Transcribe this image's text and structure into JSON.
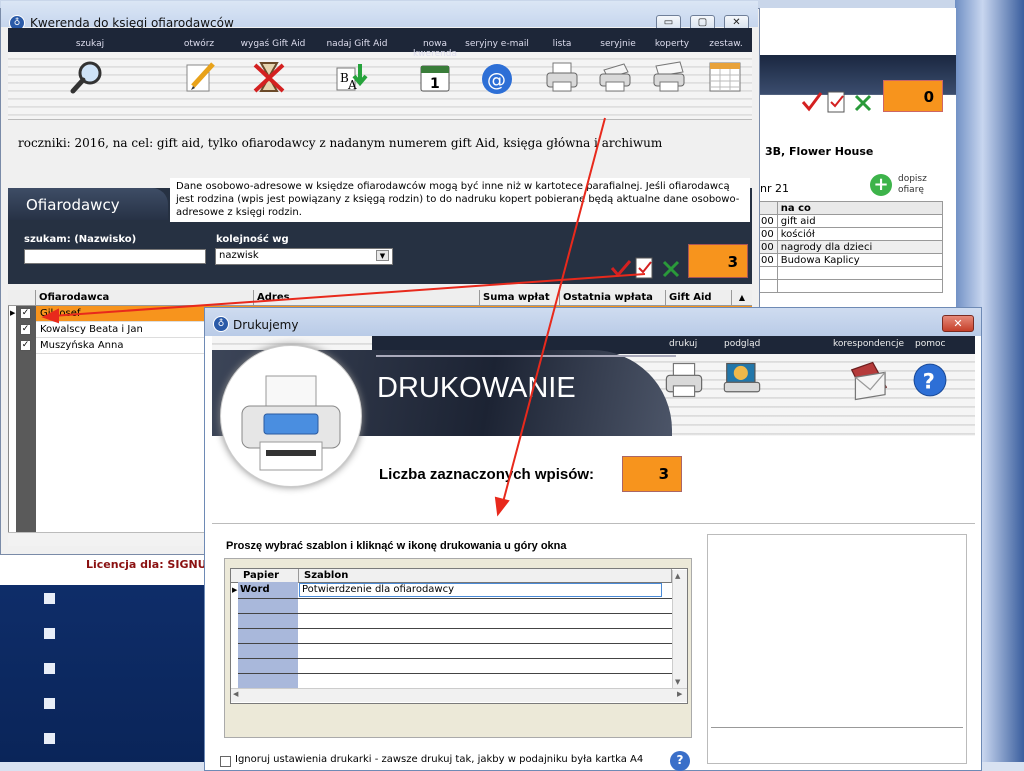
{
  "background": {
    "license_text": "Licencja dla: SIGNUM",
    "accent_red": "#e8291c",
    "accent_orange": "#f7941d",
    "right_panel": {
      "count": "0",
      "address": "3B, Flower House",
      "nr_label": "nr 21",
      "add_label_line1": "dopisz",
      "add_label_line2": "ofiarę",
      "table_header": [
        "",
        "na co"
      ],
      "table_rows": [
        [
          "00",
          "gift aid"
        ],
        [
          "00",
          "kościół"
        ],
        [
          "00",
          "nagrody dla dzieci"
        ],
        [
          "00",
          "Budowa Kaplicy"
        ]
      ]
    }
  },
  "window1": {
    "title": "Kwerenda do księgi ofiarodawców",
    "controls": {
      "minimize": "▭",
      "maximize": "▢",
      "close": "✕"
    },
    "toolbar": [
      {
        "label": "szukaj",
        "icon": "magnifier-icon"
      },
      {
        "label": "otwórz",
        "icon": "pencil-note-icon"
      },
      {
        "label": "wygaś Gift Aid",
        "icon": "hourglass-x-icon"
      },
      {
        "label": "nadaj Gift Aid",
        "icon": "ba-arrow-icon"
      },
      {
        "label": "nowa kwerenda",
        "icon": "calendar-icon"
      },
      {
        "label": "seryjny e-mail",
        "icon": "at-icon"
      },
      {
        "label": "lista",
        "icon": "printer-icon"
      },
      {
        "label": "seryjnie",
        "icon": "printer-icon"
      },
      {
        "label": "koperty",
        "icon": "envelope-printer-icon"
      },
      {
        "label": "zestaw.",
        "icon": "spreadsheet-icon"
      }
    ],
    "query_description": "roczniki: 2016,  na cel: gift aid,  tylko ofiarodawcy z nadanym numerem gift Aid,  księga główna i archiwum",
    "panel_title": "Ofiarodawcy",
    "info_text": "Dane osobowo-adresowe w księdze ofiarodawców mogą być inne niż w kartotece parafialnej. Jeśli ofiarodawcą jest rodzina (wpis jest powiązany z księgą rodzin) to do nadruku kopert pobierane będą aktualne dane osobowo-adresowe z księgi rodzin.",
    "search_label": "szukam: (Nazwisko)",
    "search_value": "",
    "order_label": "kolejność wg",
    "order_value": "nazwisk",
    "count": "3",
    "grid_headers": [
      "Ofiarodawca",
      "Adres",
      "Suma wpłat",
      "Ostatnia wpłata",
      "Gift Aid"
    ],
    "grid_rows": [
      {
        "name": "Gil Josef",
        "checked": true,
        "selected": true
      },
      {
        "name": "Kowalscy Beata i Jan",
        "checked": true,
        "selected": false
      },
      {
        "name": "Muszyńska Anna",
        "checked": true,
        "selected": false
      }
    ]
  },
  "window2": {
    "title": "Drukujemy",
    "close": "✕",
    "toolbar_labels": {
      "drukuj": "drukuj",
      "podglad": "podgląd",
      "korespondencje": "korespondencje",
      "pomoc": "pomoc"
    },
    "banner_title": "DRUKOWANIE",
    "count_label": "Liczba zaznaczonych wpisów:",
    "count": "3",
    "instruction": "Proszę wybrać szablon i kliknąć w ikonę drukowania u góry okna",
    "grid_headers": [
      "Papier",
      "Szablon"
    ],
    "grid_rows": [
      {
        "papier": "Word",
        "szablon": "Potwierdzenie dla ofiarodawcy"
      }
    ],
    "checkbox_label": "Ignoruj ustawienia drukarki - zawsze drukuj tak, jakby w podajniku była kartka A4",
    "help_glyph": "?"
  }
}
